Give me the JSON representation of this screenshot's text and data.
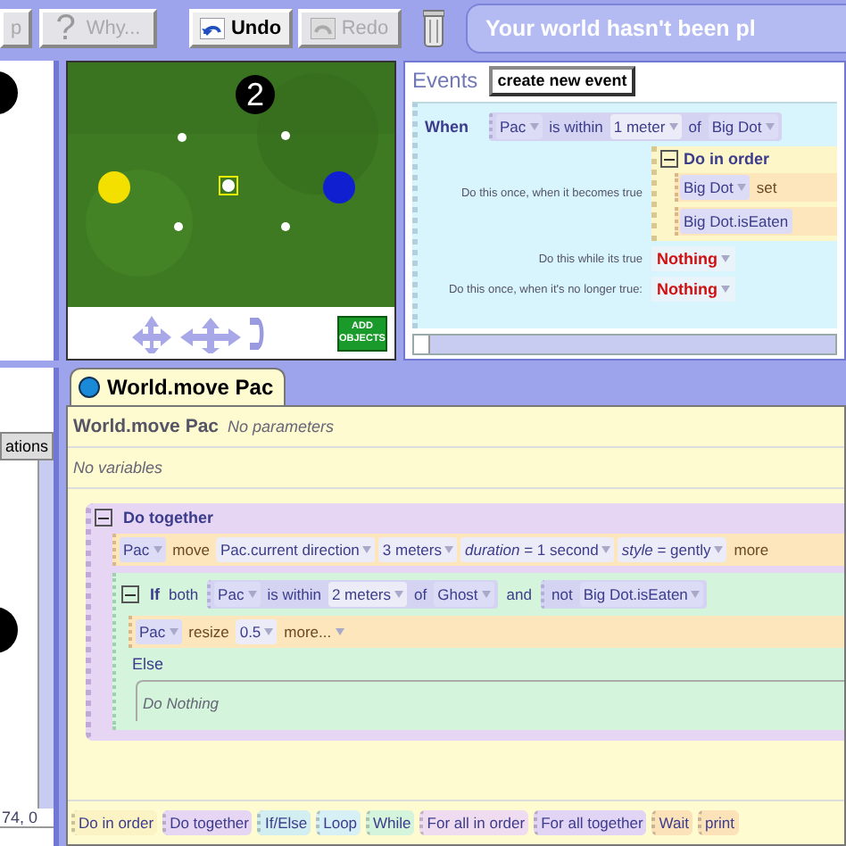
{
  "toolbar": {
    "buttons": [
      {
        "kind": "plain",
        "label": "p",
        "disabled": true
      },
      {
        "kind": "help",
        "glyph": "?",
        "label": "Why...",
        "disabled": true
      },
      {
        "kind": "undo",
        "label": "Undo",
        "disabled": false
      },
      {
        "kind": "redo",
        "label": "Redo",
        "disabled": true
      }
    ],
    "banner": "Your world hasn't been pl"
  },
  "scene": {
    "marker": "2",
    "add_objects": "ADD OBJECTS"
  },
  "events": {
    "title": "Events",
    "create_button": "create new event",
    "event": {
      "when": "When",
      "condition": [
        {
          "kind": "object",
          "text": "Pac",
          "dropdown": true
        },
        {
          "kind": "word",
          "text": "is within"
        },
        {
          "kind": "value",
          "text": "1 meter",
          "dropdown": true
        },
        {
          "kind": "word",
          "text": "of"
        },
        {
          "kind": "object",
          "text": "Big Dot",
          "dropdown": true
        }
      ],
      "becomes_true": "Do this once, when it becomes true",
      "do_in_order": {
        "label": "Do in order",
        "expanded": true,
        "statements": [
          [
            {
              "kind": "object",
              "text": "Big Dot",
              "dropdown": true
            },
            {
              "kind": "method",
              "text": "set"
            }
          ],
          [
            {
              "kind": "object",
              "text": "Big Dot.isEaten"
            }
          ]
        ]
      },
      "while_true": "Do this while its true",
      "while_value": "Nothing",
      "no_longer": "Do this once, when it's no longer true:",
      "no_longer_value": "Nothing"
    }
  },
  "side_bottom": {
    "tab": "ations",
    "coords": "74, 0"
  },
  "editor": {
    "tab": "World.move Pac",
    "method": "World.move Pac",
    "parameters": "No parameters",
    "variables": "No variables",
    "block": {
      "label": "Do together",
      "expanded": true,
      "statements": [
        {
          "kind": "call",
          "tiles": [
            {
              "kind": "object",
              "text": "Pac",
              "dropdown": true
            },
            {
              "kind": "method",
              "text": "move"
            },
            {
              "kind": "value",
              "text": "Pac.current direction",
              "dropdown": true
            },
            {
              "kind": "value",
              "text": "3 meters",
              "dropdown": true
            },
            {
              "kind": "value",
              "text": "*duration* = 1 second",
              "dropdown": true
            },
            {
              "kind": "value",
              "text": "*style* = gently",
              "dropdown": true
            },
            {
              "kind": "method",
              "text": "more"
            }
          ]
        },
        {
          "kind": "if",
          "label": "If",
          "expanded": true,
          "condition": [
            {
              "kind": "word",
              "text": "both"
            },
            {
              "kind": "group",
              "tiles": [
                {
                  "kind": "object",
                  "text": "Pac",
                  "dropdown": true
                },
                {
                  "kind": "word",
                  "text": "is within"
                },
                {
                  "kind": "value",
                  "text": "2 meters",
                  "dropdown": true
                },
                {
                  "kind": "word",
                  "text": "of"
                },
                {
                  "kind": "object",
                  "text": "Ghost",
                  "dropdown": true
                }
              ]
            },
            {
              "kind": "word",
              "text": "and"
            },
            {
              "kind": "group",
              "tiles": [
                {
                  "kind": "word",
                  "text": "not"
                },
                {
                  "kind": "object",
                  "text": "Big Dot.isEaten",
                  "dropdown": true
                }
              ]
            }
          ],
          "then": [
            [
              {
                "kind": "object",
                "text": "Pac",
                "dropdown": true
              },
              {
                "kind": "method",
                "text": "resize"
              },
              {
                "kind": "value",
                "text": "0.5",
                "dropdown": true
              },
              {
                "kind": "method",
                "text": "more...",
                "dropdown": true
              }
            ]
          ],
          "else_label": "Else",
          "else_empty": "Do Nothing"
        }
      ]
    },
    "palette": [
      {
        "label": "Do in order",
        "color": "#fbf3c4"
      },
      {
        "label": "Do together",
        "color": "#e6d6f4"
      },
      {
        "label": "If/Else",
        "color": "#d2eef0"
      },
      {
        "label": "Loop",
        "color": "#d6f0f6"
      },
      {
        "label": "While",
        "color": "#d4f4dc"
      },
      {
        "label": "For all in order",
        "color": "#f0dcf0"
      },
      {
        "label": "For all together",
        "color": "#e2d4f4"
      },
      {
        "label": "Wait",
        "color": "#fbe2b8"
      },
      {
        "label": "print",
        "color": "#fbe2b8"
      }
    ]
  }
}
